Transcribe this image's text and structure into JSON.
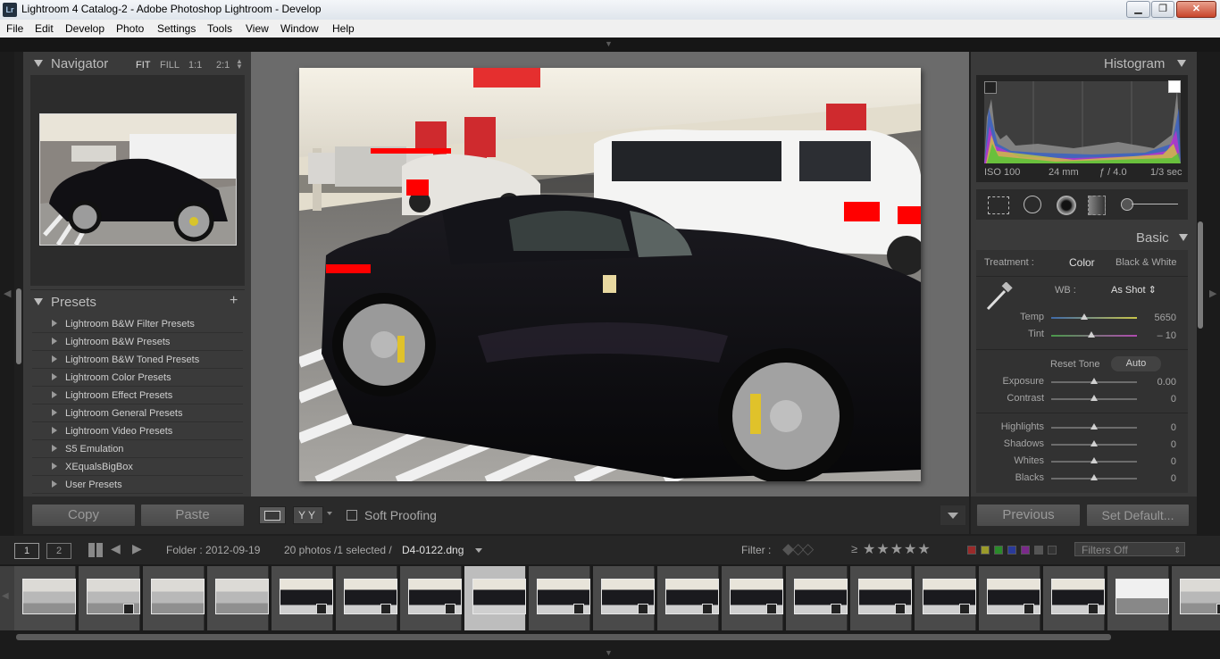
{
  "window": {
    "title": "Lightroom 4 Catalog-2 - Adobe Photoshop Lightroom - Develop",
    "app_icon": "Lr",
    "controls": [
      "minimize-icon",
      "maximize-icon",
      "close-icon"
    ]
  },
  "menu": [
    "File",
    "Edit",
    "Develop",
    "Photo",
    "Settings",
    "Tools",
    "View",
    "Window",
    "Help"
  ],
  "navigator": {
    "title": "Navigator",
    "zoom_options": [
      "FIT",
      "FILL",
      "1:1",
      "2:1"
    ],
    "zoom_active": "FIT"
  },
  "presets": {
    "title": "Presets",
    "add_label": "+",
    "items": [
      "Lightroom B&W Filter Presets",
      "Lightroom B&W Presets",
      "Lightroom B&W Toned Presets",
      "Lightroom Color Presets",
      "Lightroom Effect Presets",
      "Lightroom General Presets",
      "Lightroom Video Presets",
      "S5 Emulation",
      "XEqualsBigBox",
      "User Presets"
    ]
  },
  "left_buttons": {
    "copy": "Copy",
    "paste": "Paste"
  },
  "toolbar": {
    "soft_proofing": "Soft Proofing",
    "view_label": "YY"
  },
  "histogram": {
    "title": "Histogram",
    "iso": "ISO 100",
    "focal": "24 mm",
    "aperture": "ƒ / 4.0",
    "shutter": "1/3 sec"
  },
  "basic": {
    "title": "Basic",
    "treatment_label": "Treatment :",
    "treatment_color": "Color",
    "treatment_bw": "Black & White",
    "wb_label": "WB :",
    "wb_value": "As Shot",
    "temp_label": "Temp",
    "temp_value": "5650",
    "tint_label": "Tint",
    "tint_value": "– 10",
    "reset_tone": "Reset Tone",
    "auto": "Auto",
    "sliders": [
      {
        "label": "Exposure",
        "value": "0.00",
        "pos": 0.5
      },
      {
        "label": "Contrast",
        "value": "0",
        "pos": 0.5
      },
      {
        "label": "Highlights",
        "value": "0",
        "pos": 0.5
      },
      {
        "label": "Shadows",
        "value": "0",
        "pos": 0.5
      },
      {
        "label": "Whites",
        "value": "0",
        "pos": 0.5
      },
      {
        "label": "Blacks",
        "value": "0",
        "pos": 0.5
      }
    ],
    "temp_pos": 0.38,
    "tint_pos": 0.46
  },
  "right_buttons": {
    "previous": "Previous",
    "set_default": "Set Default..."
  },
  "filmstrip_bar": {
    "screen1": "1",
    "screen2": "2",
    "folder": "Folder : 2012-09-19",
    "count": "20 photos /1 selected /",
    "filename": "D4-0122.dng",
    "filter_label": "Filter :",
    "rating_op": "≥",
    "filters_off": "Filters Off"
  },
  "filmstrip": {
    "thumb_count": 19,
    "selected_index": 7
  }
}
